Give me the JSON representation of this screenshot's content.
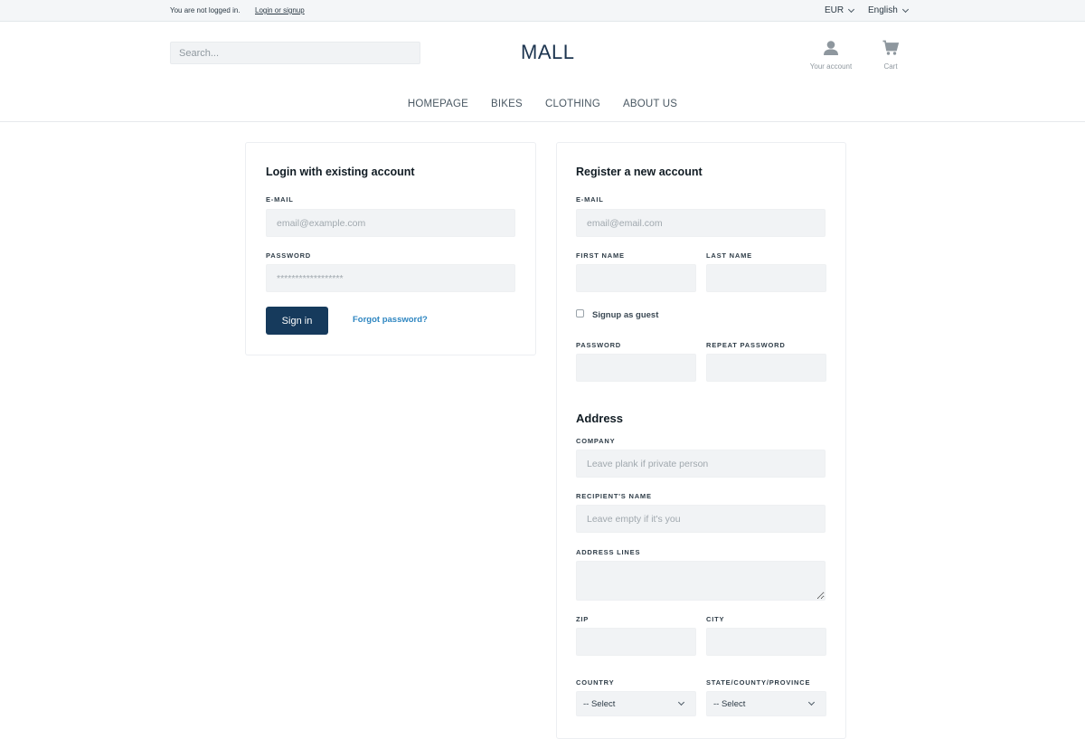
{
  "topbar": {
    "status_text": "You are not logged in.",
    "login_link": "Login or signup",
    "currency": "EUR",
    "language": "English"
  },
  "header": {
    "search_placeholder": "Search...",
    "logo": "MALL",
    "account_label": "Your account",
    "cart_label": "Cart",
    "nav": [
      "HOMEPAGE",
      "BIKES",
      "CLOTHING",
      "ABOUT US"
    ]
  },
  "login": {
    "title": "Login with existing account",
    "email_label": "E-MAIL",
    "email_placeholder": "email@example.com",
    "password_label": "PASSWORD",
    "password_placeholder": "******************",
    "sign_in": "Sign in",
    "forgot": "Forgot password?"
  },
  "register": {
    "title": "Register a new account",
    "email_label": "E-MAIL",
    "email_placeholder": "email@email.com",
    "first_name_label": "FIRST NAME",
    "last_name_label": "LAST NAME",
    "guest_label": "Signup as guest",
    "password_label": "PASSWORD",
    "repeat_password_label": "REPEAT PASSWORD",
    "address_title": "Address",
    "company_label": "COMPANY",
    "company_placeholder": "Leave plank if private person",
    "recipient_label": "RECIPIENT'S NAME",
    "recipient_placeholder": "Leave empty if it's you",
    "address_lines_label": "ADDRESS LINES",
    "zip_label": "ZIP",
    "city_label": "CITY",
    "country_label": "COUNTRY",
    "state_label": "STATE/COUNTY/PROVINCE",
    "country_value": "-- Select",
    "state_value": "-- Select"
  },
  "colors": {
    "primary": "#163a5c",
    "link": "#2e86c1",
    "field_bg": "#f1f3f5"
  }
}
